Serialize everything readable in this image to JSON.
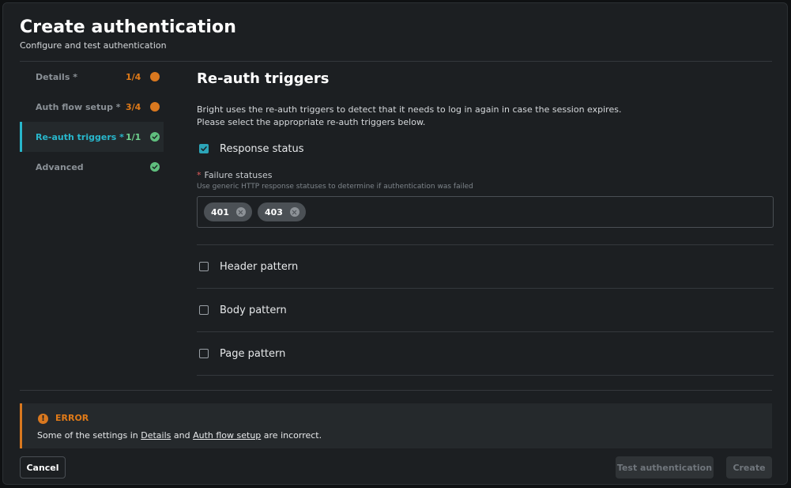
{
  "header": {
    "title": "Create authentication",
    "subtitle": "Configure and test authentication"
  },
  "steps": [
    {
      "label": "Details *",
      "count": "1/4",
      "status": "warning"
    },
    {
      "label": "Auth flow setup *",
      "count": "3/4",
      "status": "warning"
    },
    {
      "label": "Re-auth triggers *",
      "count": "1/1",
      "status": "ok",
      "active": true
    },
    {
      "label": "Advanced",
      "count": "",
      "status": "ok"
    }
  ],
  "main": {
    "section_title": "Re-auth triggers",
    "description_line1": "Bright uses the re-auth triggers to detect that it needs to log in again in case the session expires.",
    "description_line2": "Please select the appropriate re-auth triggers below.",
    "response_status": {
      "label": "Response status",
      "checked": true
    },
    "failure_statuses": {
      "required_mark": "*",
      "label": "Failure statuses",
      "hint": "Use generic HTTP response statuses to determine if authentication was failed",
      "chips": [
        "401",
        "403"
      ]
    },
    "patterns": [
      {
        "label": "Header pattern",
        "checked": false
      },
      {
        "label": "Body pattern",
        "checked": false
      },
      {
        "label": "Page pattern",
        "checked": false
      }
    ]
  },
  "error": {
    "icon": "!",
    "title": "ERROR",
    "message_prefix": "Some of the settings in ",
    "link1": "Details",
    "message_mid": " and ",
    "link2": "Auth flow setup",
    "message_suffix": " are incorrect."
  },
  "footer": {
    "cancel_label": "Cancel",
    "test_label": "Test authentication",
    "create_label": "Create"
  },
  "colors": {
    "accent": "#28b7cc",
    "warning": "#d9781f",
    "success": "#5fbe7e",
    "background": "#1c1f22"
  }
}
